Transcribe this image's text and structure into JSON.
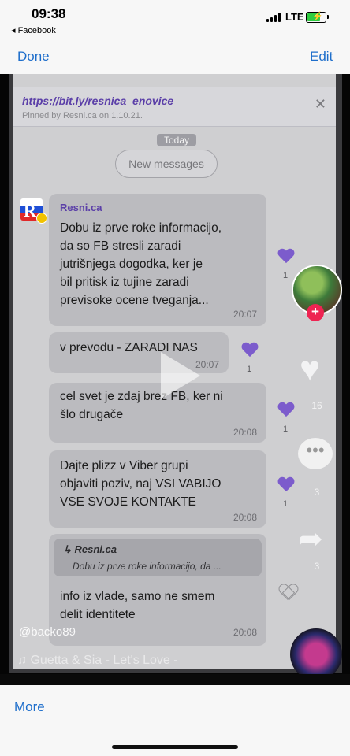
{
  "status_bar": {
    "time": "09:38",
    "back_app": "◂ Facebook",
    "network": "LTE"
  },
  "toolbar": {
    "done_label": "Done",
    "edit_label": "Edit"
  },
  "pinned": {
    "link": "https://bit.ly/resnica_enovice",
    "meta": "Pinned by Resni.ca on 1.10.21."
  },
  "chat": {
    "day_divider": "Today",
    "new_messages_label": "New messages",
    "messages": [
      {
        "sender": "Resni.ca",
        "lines": [
          "Dobu iz prve roke informacijo,",
          "da so FB stresli zaradi",
          "jutrišnjega dogodka, ker je",
          "bil pritisk iz tujine zaradi",
          "previsoke ocene tveganja..."
        ],
        "time": "20:07",
        "likes": "1"
      },
      {
        "lines": [
          "v prevodu - ZARADI NAS"
        ],
        "time": "20:07",
        "likes": "1"
      },
      {
        "lines": [
          "cel svet je zdaj brez FB, ker ni",
          "šlo drugače"
        ],
        "time": "20:08",
        "likes": "1"
      },
      {
        "lines": [
          "Dajte plizz v Viber grupi",
          "objaviti poziv, naj VSI VABIJO",
          "VSE SVOJE KONTAKTE"
        ],
        "time": "20:08",
        "likes": "1"
      },
      {
        "reply_to": {
          "name": "Resni.ca",
          "text": "Dobu iz prve roke informacijo, da ..."
        },
        "lines": [
          "info iz vlade, samo ne smem",
          "delit identitete"
        ],
        "time": "20:08"
      }
    ]
  },
  "overlay": {
    "like_count": "16",
    "comment_count": "3",
    "share_count": "3",
    "username": "@backo89",
    "music_note": "♫",
    "music_text": "Guetta & Sia - Let's Love -"
  },
  "bottom": {
    "more_label": "More"
  },
  "colors": {
    "ios_blue": "#1e6ecb",
    "sender_purple": "#5b3fa8",
    "heart_purple": "#7c5ccc",
    "tiktok_red": "#ee2452"
  }
}
